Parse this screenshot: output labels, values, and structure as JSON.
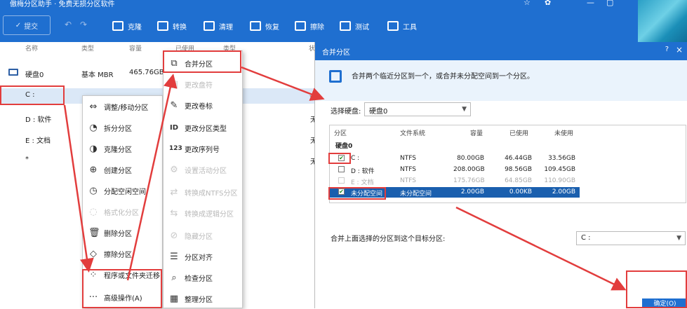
{
  "titlebar": {
    "title": "傲梅分区助手 · 免费无损分区软件",
    "controls": [
      "☆",
      "✿",
      "—",
      "▢"
    ]
  },
  "toolbar": {
    "submit": "提交",
    "items": [
      {
        "label": "克隆",
        "icon": "clone-icon"
      },
      {
        "label": "转换",
        "icon": "convert-icon"
      },
      {
        "label": "清理",
        "icon": "clean-icon"
      },
      {
        "label": "恢复",
        "icon": "restore-icon"
      },
      {
        "label": "擦除",
        "icon": "wipe-icon"
      },
      {
        "label": "测试",
        "icon": "test-icon"
      },
      {
        "label": "工具",
        "icon": "tools-icon"
      }
    ]
  },
  "columns": [
    "名称",
    "类型",
    "容量",
    "已使用",
    "类型",
    "状"
  ],
  "disk_rows": [
    {
      "name": "硬盘0",
      "type": "基本 MBR",
      "size": "465.76GB"
    },
    {
      "name": "C :",
      "type": "",
      "size": ""
    },
    {
      "name": "D : 软件",
      "type": "",
      "size": "",
      "status": "无"
    },
    {
      "name": "E : 文档",
      "type": "",
      "size": "",
      "status": "无"
    },
    {
      "name": "*",
      "type": "",
      "size": "",
      "status": "无"
    }
  ],
  "context_menu": [
    {
      "label": "调整/移动分区",
      "icon": "move-icon",
      "enabled": true
    },
    {
      "label": "拆分分区",
      "icon": "split-icon",
      "enabled": true
    },
    {
      "label": "克隆分区",
      "icon": "clone-partition-icon",
      "enabled": true
    },
    {
      "label": "创建分区",
      "icon": "create-icon",
      "enabled": true
    },
    {
      "label": "分配空闲空间",
      "icon": "allocate-icon",
      "enabled": true
    },
    {
      "label": "格式化分区",
      "icon": "format-icon",
      "enabled": false
    },
    {
      "label": "删除分区",
      "icon": "delete-icon",
      "enabled": true
    },
    {
      "label": "擦除分区",
      "icon": "erase-icon",
      "enabled": true
    },
    {
      "label": "程序或文件夹迁移",
      "icon": "migrate-icon",
      "enabled": true
    },
    {
      "label": "高级操作(A)",
      "icon": "more-icon",
      "enabled": true
    }
  ],
  "submenu": [
    {
      "label": "合并分区",
      "icon": "merge-icon",
      "enabled": true
    },
    {
      "label": "更改盘符",
      "icon": "drive-letter-icon",
      "enabled": false
    },
    {
      "label": "更改卷标",
      "icon": "pencil-icon",
      "enabled": true
    },
    {
      "label": "更改分区类型",
      "icon": "id-icon",
      "enabled": true
    },
    {
      "label": "更改序列号",
      "icon": "serial-icon",
      "enabled": true
    },
    {
      "label": "设置活动分区",
      "icon": "gear-icon",
      "enabled": false
    },
    {
      "label": "转换成NTFS分区",
      "icon": "ntfs-icon",
      "enabled": false
    },
    {
      "label": "转换成逻辑分区",
      "icon": "logical-icon",
      "enabled": false
    },
    {
      "label": "隐藏分区",
      "icon": "hide-icon",
      "enabled": false
    },
    {
      "label": "分区对齐",
      "icon": "align-icon",
      "enabled": true
    },
    {
      "label": "检查分区",
      "icon": "search-icon",
      "enabled": true
    },
    {
      "label": "整理分区",
      "icon": "defrag-icon",
      "enabled": true
    }
  ],
  "dialog": {
    "title": "合并分区",
    "help": "?",
    "close": "×",
    "description": "合并两个临近分区到一个，或合并未分配空间到一个分区。",
    "select_disk_label": "选择硬盘:",
    "select_disk_value": "硬盘0",
    "headers": [
      "分区",
      "文件系统",
      "容量",
      "已使用",
      "未使用"
    ],
    "disk_group": "硬盘0",
    "partitions": [
      {
        "name": "C :",
        "fs": "NTFS",
        "size": "80.00GB",
        "used": "46.44GB",
        "free": "33.56GB",
        "checked": true,
        "state": "normal"
      },
      {
        "name": "D : 软件",
        "fs": "NTFS",
        "size": "208.00GB",
        "used": "98.56GB",
        "free": "109.45GB",
        "checked": false,
        "state": "normal"
      },
      {
        "name": "E : 文档",
        "fs": "NTFS",
        "size": "175.76GB",
        "used": "64.85GB",
        "free": "110.90GB",
        "checked": false,
        "state": "gray"
      },
      {
        "name": "未分配空间",
        "fs": "未分配空间",
        "size": "2.00GB",
        "used": "0.00KB",
        "free": "2.00GB",
        "checked": true,
        "state": "selected"
      }
    ],
    "merge_target_label": "合并上面选择的分区到这个目标分区:",
    "merge_target_value": "C :",
    "ok_button": "确定(O)"
  }
}
